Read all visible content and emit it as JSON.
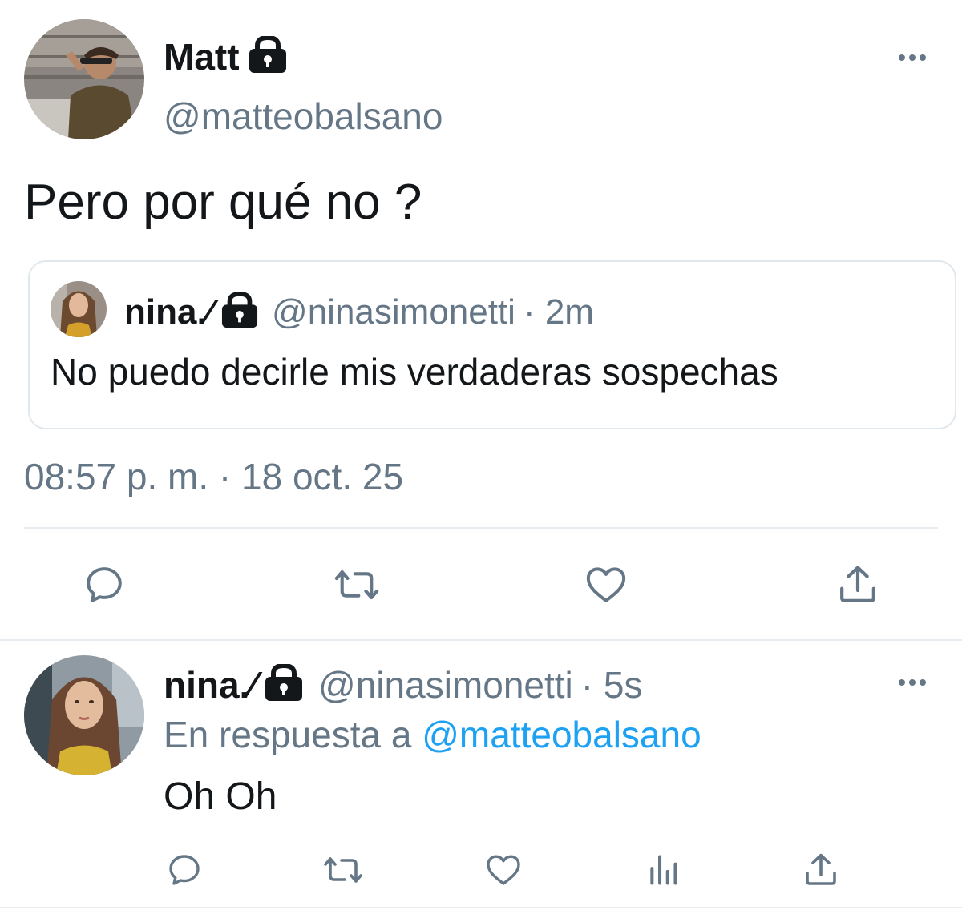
{
  "main_tweet": {
    "display_name": "Matt",
    "handle": "@matteobalsano",
    "text": "Pero por qué no ?",
    "timestamp": "08:57 p. m. · 18 oct. 25",
    "quoted": {
      "display_name": "nina.⁄",
      "handle": "@ninasimonetti",
      "time": "· 2m",
      "text": "No puedo decirle mis verdaderas sospechas"
    }
  },
  "reply_tweet": {
    "display_name": "nina.⁄",
    "handle": "@ninasimonetti",
    "time": "· 5s",
    "reply_prefix": "En respuesta a",
    "reply_to": "@matteobalsano",
    "text": "Oh Oh"
  },
  "icons": [
    "more-icon",
    "lock-icon",
    "reply-icon",
    "retweet-icon",
    "like-icon",
    "share-icon",
    "analytics-icon"
  ],
  "colors": {
    "text": "#14171a",
    "muted": "#657786",
    "link": "#1da1f2",
    "divider": "#e6ecf0"
  }
}
